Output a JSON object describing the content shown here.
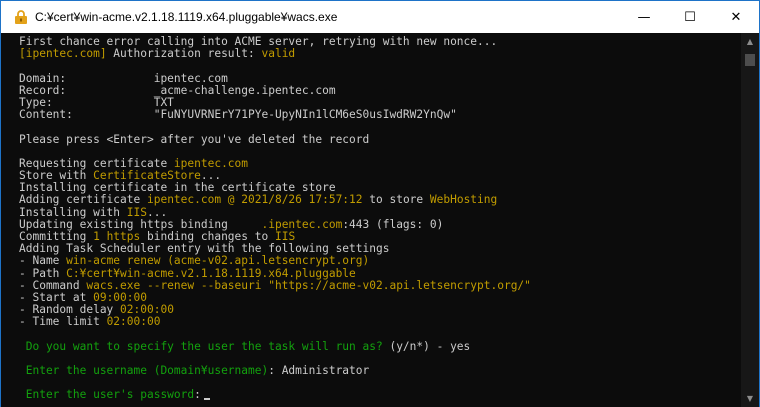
{
  "window": {
    "title": "C:¥cert¥win-acme.v2.1.18.1119.x64.pluggable¥wacs.exe",
    "icon": "lock-icon",
    "controls": {
      "minimize": "—",
      "maximize": "☐",
      "close": "✕"
    }
  },
  "console": {
    "lines": [
      [
        {
          "t": "First chance error calling into ACME server, retrying with new nonce...",
          "c": "w"
        }
      ],
      [
        {
          "t": "[ipentec.com]",
          "c": "y"
        },
        {
          "t": " Authorization result: ",
          "c": "w"
        },
        {
          "t": "valid",
          "c": "y"
        }
      ],
      [],
      [
        {
          "t": "Domain:             ipentec.com",
          "c": "w"
        }
      ],
      [
        {
          "t": "Record:             _acme-challenge.ipentec.com",
          "c": "w"
        }
      ],
      [
        {
          "t": "Type:               TXT",
          "c": "w"
        }
      ],
      [
        {
          "t": "Content:            \"FuNYUVRNErY71PYe-UpyNIn1lCM6eS0usIwdRW2YnQw\"",
          "c": "w"
        }
      ],
      [],
      [
        {
          "t": "Please press <Enter> after you've deleted the record",
          "c": "w"
        }
      ],
      [],
      [
        {
          "t": "Requesting certificate ",
          "c": "w"
        },
        {
          "t": "ipentec.com",
          "c": "y"
        }
      ],
      [
        {
          "t": "Store with ",
          "c": "w"
        },
        {
          "t": "CertificateStore",
          "c": "y"
        },
        {
          "t": "...",
          "c": "w"
        }
      ],
      [
        {
          "t": "Installing certificate in the certificate store",
          "c": "w"
        }
      ],
      [
        {
          "t": "Adding certificate ",
          "c": "w"
        },
        {
          "t": "ipentec.com @ 2021/8/26 17:57:12",
          "c": "y"
        },
        {
          "t": " to store ",
          "c": "w"
        },
        {
          "t": "WebHosting",
          "c": "y"
        }
      ],
      [
        {
          "t": "Installing with ",
          "c": "w"
        },
        {
          "t": "IIS",
          "c": "y"
        },
        {
          "t": "...",
          "c": "w"
        }
      ],
      [
        {
          "t": "Updating existing https binding     ",
          "c": "w"
        },
        {
          "t": ".ipentec.com",
          "c": "y"
        },
        {
          "t": ":443 (flags: 0)",
          "c": "w"
        }
      ],
      [
        {
          "t": "Committing ",
          "c": "w"
        },
        {
          "t": "1 https",
          "c": "y"
        },
        {
          "t": " binding changes to ",
          "c": "w"
        },
        {
          "t": "IIS",
          "c": "y"
        }
      ],
      [
        {
          "t": "Adding Task Scheduler entry with the following settings",
          "c": "w"
        }
      ],
      [
        {
          "t": "- Name ",
          "c": "w"
        },
        {
          "t": "win-acme renew (acme-v02.api.letsencrypt.org)",
          "c": "y"
        }
      ],
      [
        {
          "t": "- Path ",
          "c": "w"
        },
        {
          "t": "C:¥cert¥win-acme.v2.1.18.1119.x64.pluggable",
          "c": "y"
        }
      ],
      [
        {
          "t": "- Command ",
          "c": "w"
        },
        {
          "t": "wacs.exe --renew --baseuri \"https://acme-v02.api.letsencrypt.org/\"",
          "c": "y"
        }
      ],
      [
        {
          "t": "- Start at ",
          "c": "w"
        },
        {
          "t": "09:00:00",
          "c": "y"
        }
      ],
      [
        {
          "t": "- Random delay ",
          "c": "w"
        },
        {
          "t": "02:00:00",
          "c": "y"
        }
      ],
      [
        {
          "t": "- Time limit ",
          "c": "w"
        },
        {
          "t": "02:00:00",
          "c": "y"
        }
      ],
      [],
      [
        {
          "t": " Do you want to specify the user the task will run as?",
          "c": "g"
        },
        {
          "t": " (y/n*) - yes",
          "c": "w"
        }
      ],
      [],
      [
        {
          "t": " Enter the username (Domain¥username)",
          "c": "g"
        },
        {
          "t": ": Administrator",
          "c": "w"
        }
      ],
      [],
      [
        {
          "t": " Enter the user's password",
          "c": "g"
        },
        {
          "t": ":",
          "c": "w"
        }
      ]
    ]
  },
  "scrollbar": {
    "up": "▲",
    "down": "▼"
  }
}
